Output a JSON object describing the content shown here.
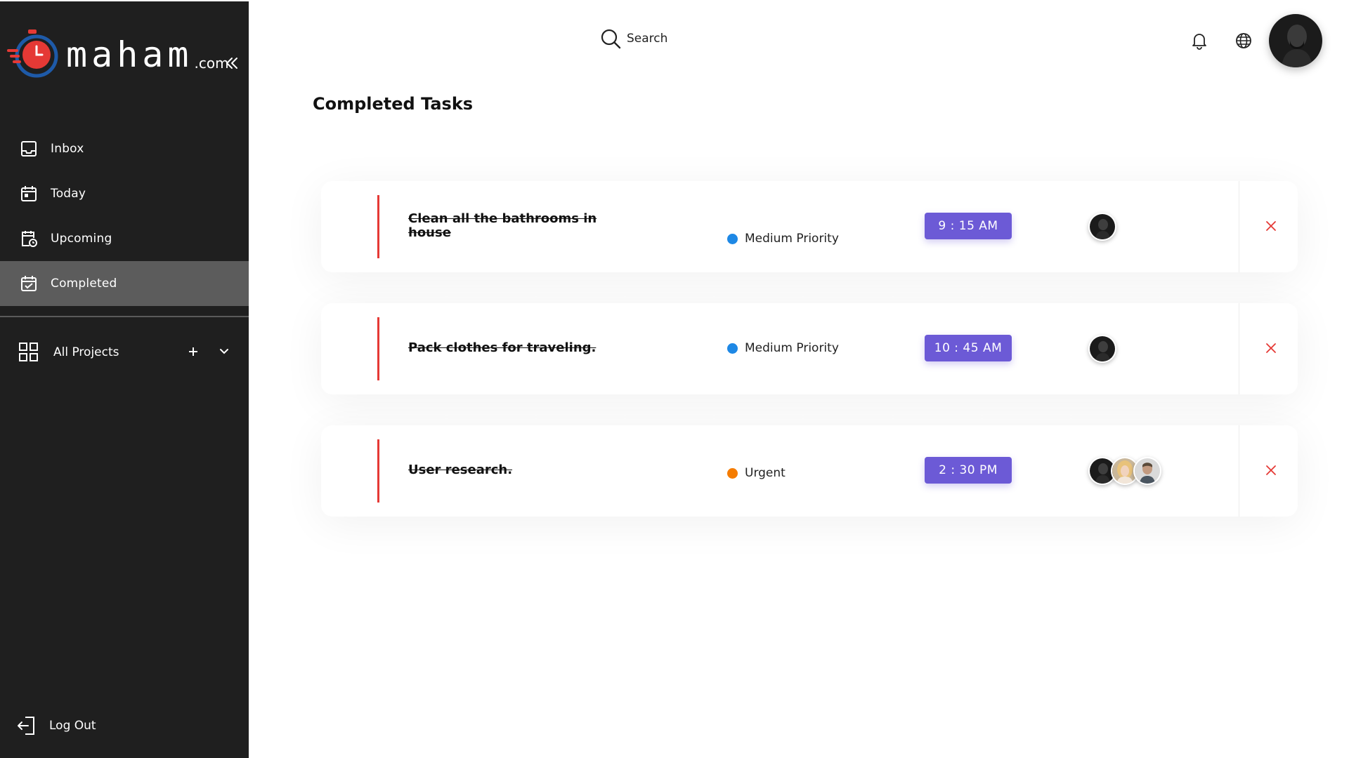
{
  "brand": {
    "name": "maham",
    "tld": ".com"
  },
  "sidebar": {
    "items": [
      {
        "label": "Inbox",
        "icon": "inbox-icon"
      },
      {
        "label": "Today",
        "icon": "calendar-today-icon"
      },
      {
        "label": "Upcoming",
        "icon": "calendar-clock-icon"
      },
      {
        "label": "Completed",
        "icon": "calendar-check-icon",
        "active": true
      }
    ],
    "projects_label": "All Projects",
    "logout_label": "Log Out"
  },
  "header": {
    "search_label": "Search"
  },
  "main": {
    "title": "Completed Tasks",
    "tasks": [
      {
        "title": "Clean all the bathrooms in house",
        "priority": "Medium Priority",
        "priority_color": "#1e88e5",
        "time": "9 : 15 AM",
        "assignees": 1
      },
      {
        "title": "Pack clothes for traveling.",
        "priority": "Medium Priority",
        "priority_color": "#1e88e5",
        "time": "10 : 45 AM",
        "assignees": 1
      },
      {
        "title": "User research.",
        "priority": "Urgent",
        "priority_color": "#f57c00",
        "time": "2 : 30 PM",
        "assignees": 3
      }
    ]
  },
  "colors": {
    "sidebar_bg": "#1f1f1f",
    "active_bg": "#5c5c5c",
    "accent_purple": "#6c5ad6",
    "accent_red": "#e53935"
  }
}
